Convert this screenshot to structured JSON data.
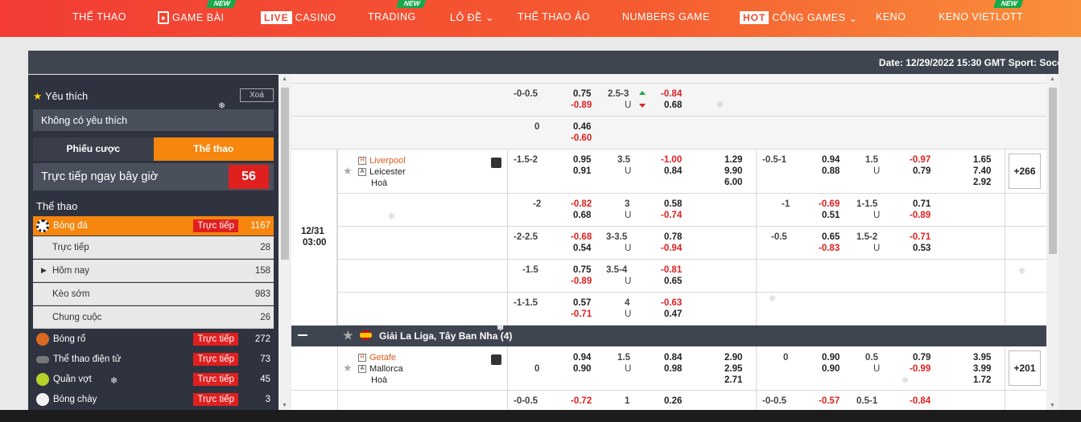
{
  "nav": {
    "items": [
      {
        "label": "THỂ THAO"
      },
      {
        "label": "GAME BÀI",
        "new": "NEW"
      },
      {
        "box": "LIVE",
        "label": "CASINO"
      },
      {
        "label": "TRADING",
        "new": "NEW"
      },
      {
        "label": "LÔ ĐỀ"
      },
      {
        "label": "THỂ THAO ẢO"
      },
      {
        "label": "NUMBERS GAME"
      },
      {
        "box": "HOT",
        "label": "CỔNG GAMES"
      },
      {
        "label": "KENO"
      },
      {
        "label": "KENO VIETLOTT",
        "new": "NEW"
      }
    ]
  },
  "infobar": {
    "text": "Date: 12/29/2022 15:30 GMT Sport: Socc"
  },
  "sidebar": {
    "fav_title": "Yêu thích",
    "clear": "Xoá",
    "no_fav": "Không có yêu thích",
    "tab_bets": "Phiếu cược",
    "tab_sports": "Thể thao",
    "live_now": "Trực tiếp ngay bây giờ",
    "live_count": "56",
    "sports_title": "Thể thao",
    "live_badge": "Trực tiếp",
    "football": {
      "label": "Bóng đá",
      "count": "1167"
    },
    "sub": [
      {
        "label": "Trực tiếp",
        "count": "28"
      },
      {
        "label": "Hôm nay",
        "count": "158"
      },
      {
        "label": "Kèo sớm",
        "count": "983"
      },
      {
        "label": "Chung cuộc",
        "count": "26"
      }
    ],
    "sports": [
      {
        "label": "Bóng rổ",
        "count": "272"
      },
      {
        "label": "Thể thao điện tử",
        "count": "73"
      },
      {
        "label": "Quần vợt",
        "count": "45"
      },
      {
        "label": "Bóng chày",
        "count": "3"
      }
    ]
  },
  "rows": {
    "r0": {
      "a1": "-0-0.5",
      "b1": "0.75",
      "b2": "-0.89",
      "c1": "2.5-3",
      "c2": "U",
      "d1": "-0.84",
      "d2": "0.68"
    },
    "r1": {
      "a1": "0",
      "b1": "0.46",
      "b2": "-0.60"
    },
    "m1": {
      "date": "12/31",
      "time": "03:00",
      "home": "Liverpool",
      "away": "Leicester",
      "draw": "Hoà",
      "a1": "-1.5-2",
      "b1": "0.95",
      "b2": "0.91",
      "c1": "3.5",
      "c2": "U",
      "d1": "-1.00",
      "d2": "0.84",
      "e1": "1.29",
      "e2": "9.90",
      "e3": "6.00",
      "f1": "-0.5-1",
      "g1": "0.94",
      "g2": "0.88",
      "h1": "1.5",
      "h2": "U",
      "i1": "-0.97",
      "i2": "0.79",
      "j1": "1.65",
      "j2": "7.40",
      "j3": "2.92",
      "more": "+266"
    },
    "m1r2": {
      "a1": "-2",
      "b1": "-0.82",
      "b2": "0.68",
      "c1": "3",
      "c2": "U",
      "d1": "0.58",
      "d2": "-0.74",
      "f1": "-1",
      "g1": "-0.69",
      "g2": "0.51",
      "h1": "1-1.5",
      "h2": "U",
      "i1": "0.71",
      "i2": "-0.89"
    },
    "m1r3": {
      "a1": "-2-2.5",
      "b1": "-0.68",
      "b2": "0.54",
      "c1": "3-3.5",
      "c2": "U",
      "d1": "0.78",
      "d2": "-0.94",
      "f1": "-0.5",
      "g1": "0.65",
      "g2": "-0.83",
      "h1": "1.5-2",
      "h2": "U",
      "i1": "-0.71",
      "i2": "0.53"
    },
    "m1r4": {
      "a1": "-1.5",
      "b1": "0.75",
      "b2": "-0.89",
      "c1": "3.5-4",
      "c2": "U",
      "d1": "-0.81",
      "d2": "0.65"
    },
    "m1r5": {
      "a1": "-1-1.5",
      "b1": "0.57",
      "b2": "-0.71",
      "c1": "4",
      "c2": "U",
      "d1": "-0.63",
      "d2": "0.47"
    },
    "league": {
      "title": "Giải La Liga, Tây Ban Nha (4)"
    },
    "m2": {
      "home": "Getafe",
      "away": "Mallorca",
      "draw": "Hoà",
      "a1": "0",
      "b1": "0.94",
      "b2": "0.90",
      "c1": "1.5",
      "c2": "U",
      "d1": "0.84",
      "d2": "0.98",
      "e1": "2.90",
      "e2": "2.95",
      "e3": "2.71",
      "f1": "0",
      "g1": "0.90",
      "g2": "0.90",
      "h1": "0.5",
      "h2": "U",
      "i1": "0.79",
      "i2": "-0.99",
      "j1": "3.95",
      "j2": "3.99",
      "j3": "1.72",
      "more": "+201"
    },
    "m2r2": {
      "a1": "-0-0.5",
      "b1": "-0.72",
      "c1": "1",
      "d1": "0.26",
      "f1": "-0-0.5",
      "g1": "-0.57",
      "h1": "0.5-1",
      "i1": "-0.84"
    }
  }
}
